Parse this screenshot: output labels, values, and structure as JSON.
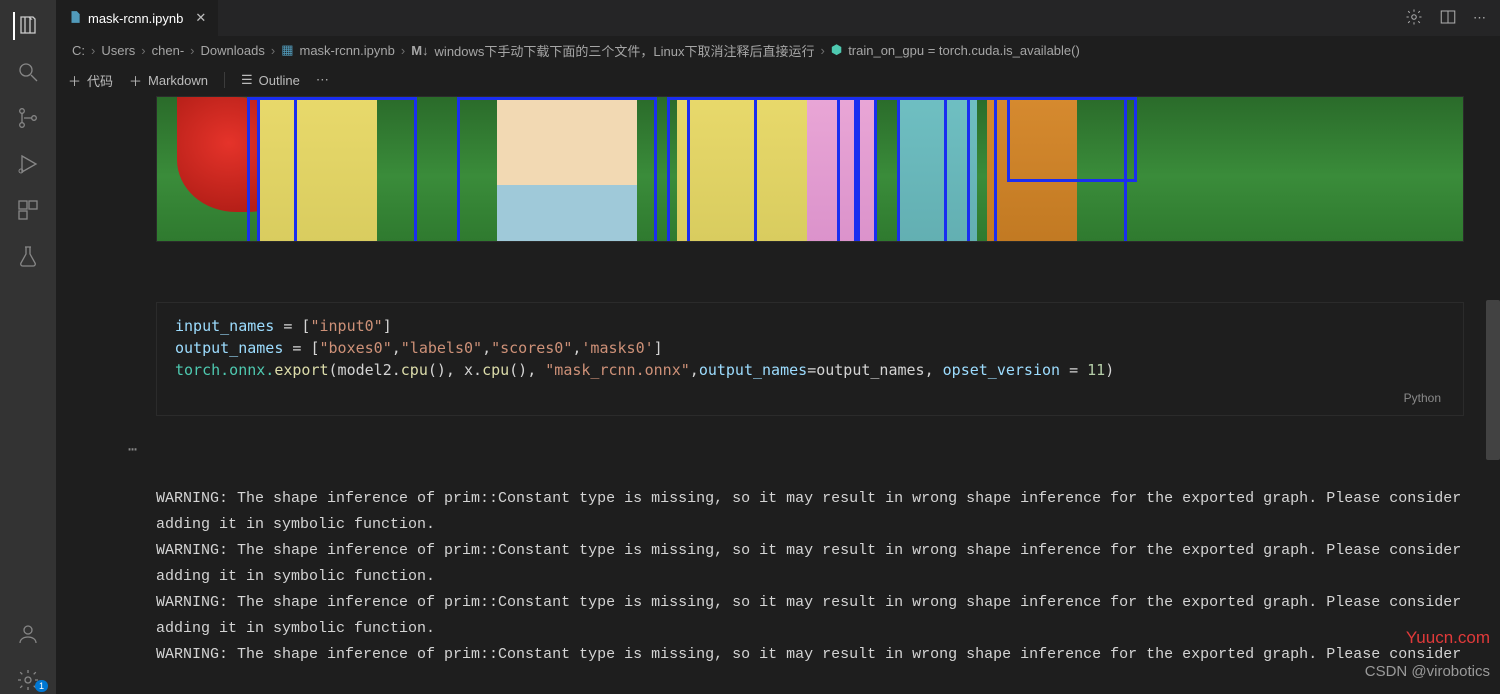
{
  "tab": {
    "filename": "mask-rcnn.ipynb"
  },
  "breadcrumb": {
    "parts": [
      "C:",
      "Users",
      "chen-",
      "Downloads",
      "mask-rcnn.ipynb"
    ],
    "md_section": "windows下手动下载下面的三个文件，Linux下取消注释后直接运行",
    "py_symbol": "train_on_gpu = torch.cuda.is_available()"
  },
  "toolbar": {
    "code_btn": "代码",
    "markdown_btn": "Markdown",
    "outline_btn": "Outline"
  },
  "code_cell": {
    "language": "Python",
    "lines": {
      "l1_a": "input_names",
      "l1_b": " = [",
      "l1_c": "\"input0\"",
      "l1_d": "]",
      "l2_a": "output_names",
      "l2_b": " = [",
      "l2_c": "\"boxes0\"",
      "l2_d": ",",
      "l2_e": "\"labels0\"",
      "l2_f": ",",
      "l2_g": "\"scores0\"",
      "l2_h": ",",
      "l2_i": "'masks0'",
      "l2_j": "]",
      "l3_a": "torch.onnx.",
      "l3_b": "export",
      "l3_c": "(model2.",
      "l3_d": "cpu",
      "l3_e": "(), x.",
      "l3_f": "cpu",
      "l3_g": "(), ",
      "l3_h": "\"mask_rcnn.onnx\"",
      "l3_i": ",",
      "l3_j": "output_names",
      "l3_k": "=output_names, ",
      "l3_l": "opset_version",
      "l3_m": " = ",
      "l3_n": "11",
      "l3_o": ")"
    }
  },
  "output": {
    "warn1": "WARNING: The shape inference of prim::Constant type is missing, so it may result in wrong shape inference for the exported graph. Please consider adding it in symbolic function.",
    "warn2": "WARNING: The shape inference of prim::Constant type is missing, so it may result in wrong shape inference for the exported graph. Please consider adding it in symbolic function.",
    "warn3": "WARNING: The shape inference of prim::Constant type is missing, so it may result in wrong shape inference for the exported graph. Please consider adding it in symbolic function.",
    "warn4": "WARNING: The shape inference of prim::Constant type is missing, so it may result in wrong shape inference for the exported graph. Please consider"
  },
  "watermarks": {
    "site": "Yuucn.com",
    "author": "CSDN @virobotics"
  },
  "badge": {
    "count": "1"
  },
  "gutter": "⋯"
}
